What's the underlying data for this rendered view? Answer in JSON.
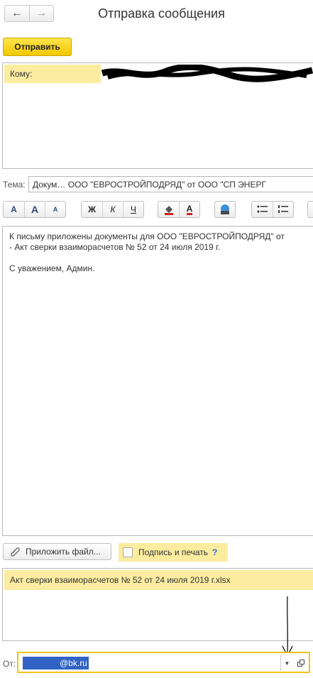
{
  "window": {
    "title": "Отправка сообщения"
  },
  "nav": {
    "back_icon": "←",
    "forward_icon": "→"
  },
  "toolbar": {
    "send_label": "Отправить"
  },
  "recipient": {
    "label": "Кому:"
  },
  "subject": {
    "label": "Тема:",
    "value": "Докум… ООО \"ЕВРОСТРОЙПОДРЯД\" от ООО \"СП ЭНЕРГ"
  },
  "format_toolbar": {
    "font_buttons": [
      "A",
      "A",
      "A"
    ],
    "style_buttons": [
      "Ж",
      "К",
      "Ч"
    ],
    "color_buttons": [
      "◆",
      "A"
    ]
  },
  "body": {
    "lines": [
      "К письму приложены документы для ООО \"ЕВРОСТРОЙПОДРЯД\" от",
      "- Акт сверки взаиморасчетов № 52 от 24 июля 2019 г.",
      "",
      "С уважением, Админ."
    ]
  },
  "attach": {
    "button_label": "Приложить файл...",
    "sign_label": "Подпись и печать",
    "help": "?"
  },
  "attachments": [
    "Акт сверки взаиморасчетов № 52 от 24 июля 2019 г.xlsx"
  ],
  "from": {
    "label": "От:",
    "value": "@bk.ru"
  },
  "colors": {
    "accent_yellow": "#f2c800",
    "row_highlight": "#fbeca0",
    "selection_blue": "#3163c5"
  }
}
